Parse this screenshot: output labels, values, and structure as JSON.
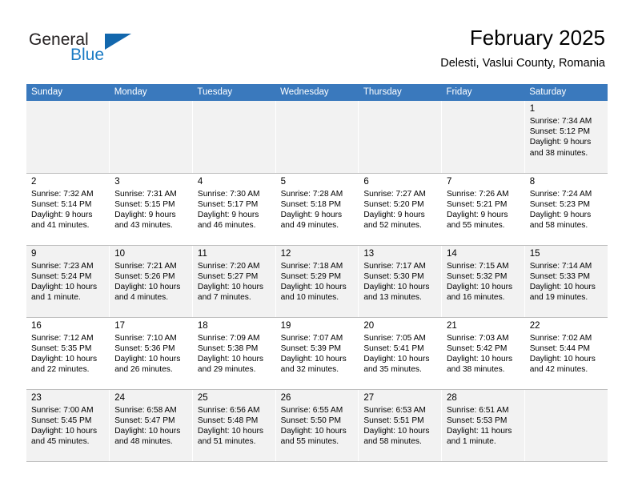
{
  "brand": {
    "name_top": "General",
    "name_bottom": "Blue",
    "triangle_icon": "triangle-icon",
    "accent_color": "#1267ad",
    "text_color": "#231f20"
  },
  "header": {
    "title": "February 2025",
    "subtitle": "Delesti, Vaslui County, Romania"
  },
  "calendar": {
    "header_bg": "#3a79bd",
    "header_text_color": "#ffffff",
    "shaded_row_bg": "#f2f2f2",
    "weekdays": [
      "Sunday",
      "Monday",
      "Tuesday",
      "Wednesday",
      "Thursday",
      "Friday",
      "Saturday"
    ],
    "weeks": [
      [
        {
          "day": "",
          "sunrise": "",
          "sunset": "",
          "daylight_line1": "",
          "daylight_line2": ""
        },
        {
          "day": "",
          "sunrise": "",
          "sunset": "",
          "daylight_line1": "",
          "daylight_line2": ""
        },
        {
          "day": "",
          "sunrise": "",
          "sunset": "",
          "daylight_line1": "",
          "daylight_line2": ""
        },
        {
          "day": "",
          "sunrise": "",
          "sunset": "",
          "daylight_line1": "",
          "daylight_line2": ""
        },
        {
          "day": "",
          "sunrise": "",
          "sunset": "",
          "daylight_line1": "",
          "daylight_line2": ""
        },
        {
          "day": "",
          "sunrise": "",
          "sunset": "",
          "daylight_line1": "",
          "daylight_line2": ""
        },
        {
          "day": "1",
          "sunrise": "Sunrise: 7:34 AM",
          "sunset": "Sunset: 5:12 PM",
          "daylight_line1": "Daylight: 9 hours",
          "daylight_line2": "and 38 minutes."
        }
      ],
      [
        {
          "day": "2",
          "sunrise": "Sunrise: 7:32 AM",
          "sunset": "Sunset: 5:14 PM",
          "daylight_line1": "Daylight: 9 hours",
          "daylight_line2": "and 41 minutes."
        },
        {
          "day": "3",
          "sunrise": "Sunrise: 7:31 AM",
          "sunset": "Sunset: 5:15 PM",
          "daylight_line1": "Daylight: 9 hours",
          "daylight_line2": "and 43 minutes."
        },
        {
          "day": "4",
          "sunrise": "Sunrise: 7:30 AM",
          "sunset": "Sunset: 5:17 PM",
          "daylight_line1": "Daylight: 9 hours",
          "daylight_line2": "and 46 minutes."
        },
        {
          "day": "5",
          "sunrise": "Sunrise: 7:28 AM",
          "sunset": "Sunset: 5:18 PM",
          "daylight_line1": "Daylight: 9 hours",
          "daylight_line2": "and 49 minutes."
        },
        {
          "day": "6",
          "sunrise": "Sunrise: 7:27 AM",
          "sunset": "Sunset: 5:20 PM",
          "daylight_line1": "Daylight: 9 hours",
          "daylight_line2": "and 52 minutes."
        },
        {
          "day": "7",
          "sunrise": "Sunrise: 7:26 AM",
          "sunset": "Sunset: 5:21 PM",
          "daylight_line1": "Daylight: 9 hours",
          "daylight_line2": "and 55 minutes."
        },
        {
          "day": "8",
          "sunrise": "Sunrise: 7:24 AM",
          "sunset": "Sunset: 5:23 PM",
          "daylight_line1": "Daylight: 9 hours",
          "daylight_line2": "and 58 minutes."
        }
      ],
      [
        {
          "day": "9",
          "sunrise": "Sunrise: 7:23 AM",
          "sunset": "Sunset: 5:24 PM",
          "daylight_line1": "Daylight: 10 hours",
          "daylight_line2": "and 1 minute."
        },
        {
          "day": "10",
          "sunrise": "Sunrise: 7:21 AM",
          "sunset": "Sunset: 5:26 PM",
          "daylight_line1": "Daylight: 10 hours",
          "daylight_line2": "and 4 minutes."
        },
        {
          "day": "11",
          "sunrise": "Sunrise: 7:20 AM",
          "sunset": "Sunset: 5:27 PM",
          "daylight_line1": "Daylight: 10 hours",
          "daylight_line2": "and 7 minutes."
        },
        {
          "day": "12",
          "sunrise": "Sunrise: 7:18 AM",
          "sunset": "Sunset: 5:29 PM",
          "daylight_line1": "Daylight: 10 hours",
          "daylight_line2": "and 10 minutes."
        },
        {
          "day": "13",
          "sunrise": "Sunrise: 7:17 AM",
          "sunset": "Sunset: 5:30 PM",
          "daylight_line1": "Daylight: 10 hours",
          "daylight_line2": "and 13 minutes."
        },
        {
          "day": "14",
          "sunrise": "Sunrise: 7:15 AM",
          "sunset": "Sunset: 5:32 PM",
          "daylight_line1": "Daylight: 10 hours",
          "daylight_line2": "and 16 minutes."
        },
        {
          "day": "15",
          "sunrise": "Sunrise: 7:14 AM",
          "sunset": "Sunset: 5:33 PM",
          "daylight_line1": "Daylight: 10 hours",
          "daylight_line2": "and 19 minutes."
        }
      ],
      [
        {
          "day": "16",
          "sunrise": "Sunrise: 7:12 AM",
          "sunset": "Sunset: 5:35 PM",
          "daylight_line1": "Daylight: 10 hours",
          "daylight_line2": "and 22 minutes."
        },
        {
          "day": "17",
          "sunrise": "Sunrise: 7:10 AM",
          "sunset": "Sunset: 5:36 PM",
          "daylight_line1": "Daylight: 10 hours",
          "daylight_line2": "and 26 minutes."
        },
        {
          "day": "18",
          "sunrise": "Sunrise: 7:09 AM",
          "sunset": "Sunset: 5:38 PM",
          "daylight_line1": "Daylight: 10 hours",
          "daylight_line2": "and 29 minutes."
        },
        {
          "day": "19",
          "sunrise": "Sunrise: 7:07 AM",
          "sunset": "Sunset: 5:39 PM",
          "daylight_line1": "Daylight: 10 hours",
          "daylight_line2": "and 32 minutes."
        },
        {
          "day": "20",
          "sunrise": "Sunrise: 7:05 AM",
          "sunset": "Sunset: 5:41 PM",
          "daylight_line1": "Daylight: 10 hours",
          "daylight_line2": "and 35 minutes."
        },
        {
          "day": "21",
          "sunrise": "Sunrise: 7:03 AM",
          "sunset": "Sunset: 5:42 PM",
          "daylight_line1": "Daylight: 10 hours",
          "daylight_line2": "and 38 minutes."
        },
        {
          "day": "22",
          "sunrise": "Sunrise: 7:02 AM",
          "sunset": "Sunset: 5:44 PM",
          "daylight_line1": "Daylight: 10 hours",
          "daylight_line2": "and 42 minutes."
        }
      ],
      [
        {
          "day": "23",
          "sunrise": "Sunrise: 7:00 AM",
          "sunset": "Sunset: 5:45 PM",
          "daylight_line1": "Daylight: 10 hours",
          "daylight_line2": "and 45 minutes."
        },
        {
          "day": "24",
          "sunrise": "Sunrise: 6:58 AM",
          "sunset": "Sunset: 5:47 PM",
          "daylight_line1": "Daylight: 10 hours",
          "daylight_line2": "and 48 minutes."
        },
        {
          "day": "25",
          "sunrise": "Sunrise: 6:56 AM",
          "sunset": "Sunset: 5:48 PM",
          "daylight_line1": "Daylight: 10 hours",
          "daylight_line2": "and 51 minutes."
        },
        {
          "day": "26",
          "sunrise": "Sunrise: 6:55 AM",
          "sunset": "Sunset: 5:50 PM",
          "daylight_line1": "Daylight: 10 hours",
          "daylight_line2": "and 55 minutes."
        },
        {
          "day": "27",
          "sunrise": "Sunrise: 6:53 AM",
          "sunset": "Sunset: 5:51 PM",
          "daylight_line1": "Daylight: 10 hours",
          "daylight_line2": "and 58 minutes."
        },
        {
          "day": "28",
          "sunrise": "Sunrise: 6:51 AM",
          "sunset": "Sunset: 5:53 PM",
          "daylight_line1": "Daylight: 11 hours",
          "daylight_line2": "and 1 minute."
        },
        {
          "day": "",
          "sunrise": "",
          "sunset": "",
          "daylight_line1": "",
          "daylight_line2": ""
        }
      ]
    ]
  }
}
